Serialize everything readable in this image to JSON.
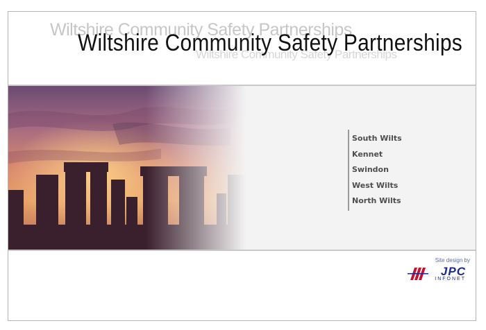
{
  "header": {
    "title": "Wiltshire Community Safety Partnerships",
    "ghost_title": "Wiltshire Community Safety Partnerships"
  },
  "nav": {
    "items": [
      {
        "label": "South Wilts"
      },
      {
        "label": "Kennet"
      },
      {
        "label": "Swindon"
      },
      {
        "label": "West Wilts"
      },
      {
        "label": "North Wilts"
      }
    ]
  },
  "credit": {
    "text": "Site design by",
    "logo_word": "JPC",
    "logo_sub": "INFONET"
  },
  "colors": {
    "brand_blue": "#1a2a8a",
    "logo_red": "#c8102e"
  }
}
